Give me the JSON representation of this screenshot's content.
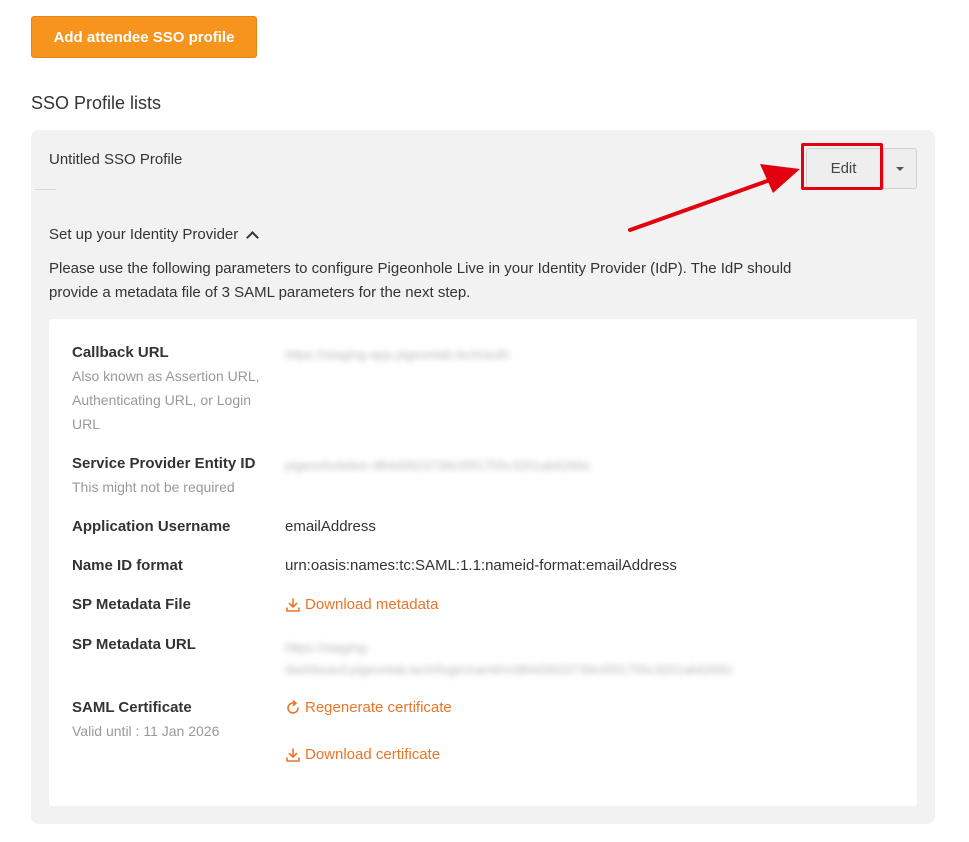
{
  "actions": {
    "add_sso_profile": "Add attendee SSO profile"
  },
  "section_title": "SSO Profile lists",
  "profile": {
    "name": "Untitled SSO Profile",
    "edit_label": "Edit",
    "idp_section_title": "Set up your Identity Provider",
    "idp_description": "Please use the following parameters to configure Pigeonhole Live in your Identity Provider (IdP). The IdP should provide a metadata file of 3 SAML parameters for the next step.",
    "params": {
      "callback_url": {
        "label": "Callback URL",
        "hint": "Also known as Assertion URL, Authenticating URL, or Login URL",
        "value": "https://staging-app.pigeonlab.tech/auth"
      },
      "sp_entity_id": {
        "label": "Service Provider Entity ID",
        "hint": "This might not be required",
        "value": "pigeonholelive-d84d3923739c05f1755c3201ab6266c"
      },
      "app_username": {
        "label": "Application Username",
        "value": "emailAddress"
      },
      "name_id_format": {
        "label": "Name ID format",
        "value": "urn:oasis:names:tc:SAML:1.1:nameid-format:emailAddress"
      },
      "sp_metadata_file": {
        "label": "SP Metadata File",
        "link": "Download metadata"
      },
      "sp_metadata_url": {
        "label": "SP Metadata URL",
        "value_line1": "https://staging-",
        "value_line2": "dashboard.pigeonlab.tech/login/saml/m/d84d3923739c05f1755c3201ab6266c"
      },
      "saml_certificate": {
        "label": "SAML Certificate",
        "hint": "Valid until : 11 Jan 2026",
        "regenerate_link": "Regenerate certificate",
        "download_link": "Download certificate"
      }
    }
  },
  "colors": {
    "primary_button": "#f7941d",
    "link": "#ea7528",
    "annotation": "#e3000f"
  }
}
